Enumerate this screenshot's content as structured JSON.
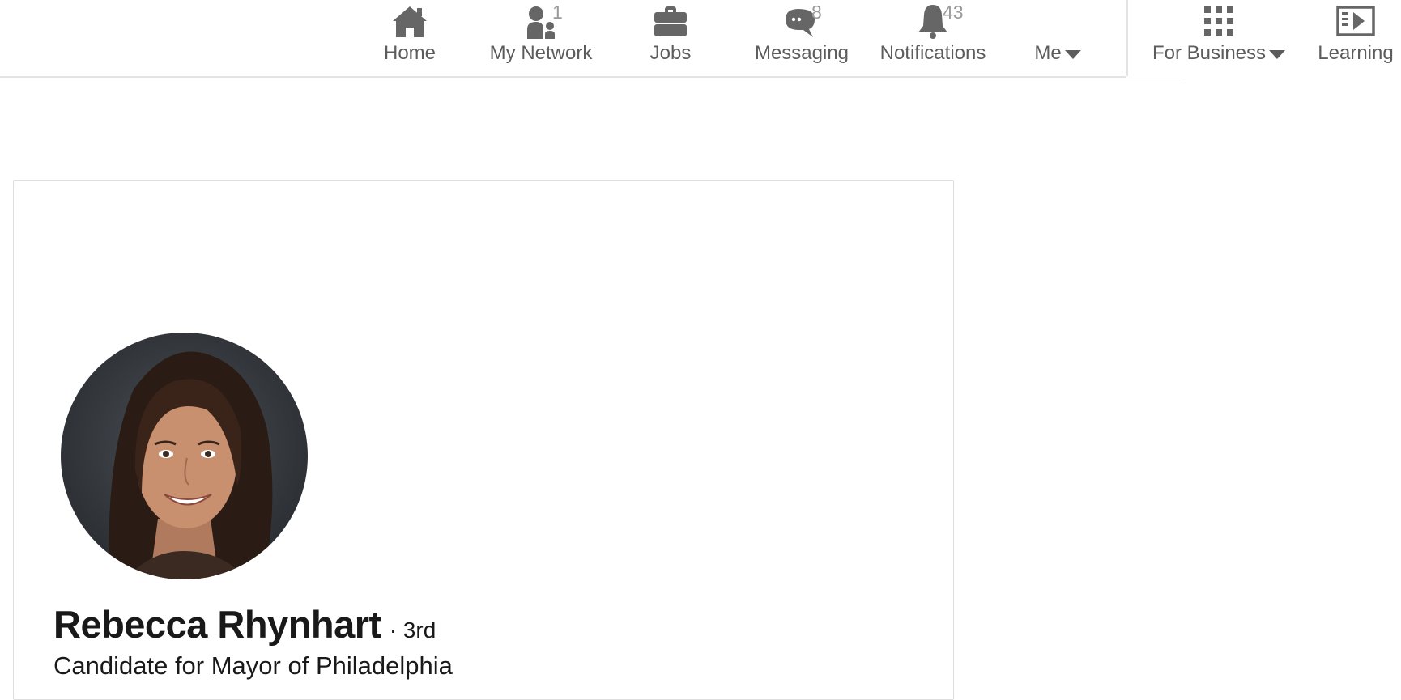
{
  "nav": {
    "home": {
      "label": "Home"
    },
    "network": {
      "label": "My Network",
      "badge": "1"
    },
    "jobs": {
      "label": "Jobs"
    },
    "messaging": {
      "label": "Messaging",
      "badge": "8"
    },
    "notifications": {
      "label": "Notifications",
      "badge": "43"
    },
    "me": {
      "label": "Me"
    },
    "for_business": {
      "label": "For Business"
    },
    "learning": {
      "label": "Learning"
    }
  },
  "profile": {
    "name": "Rebecca Rhynhart",
    "degree": "· 3rd",
    "headline": "Candidate for Mayor of Philadelphia"
  },
  "colors": {
    "nav_icon": "#666666",
    "nav_label": "#5c5c5c",
    "badge": "#9a9a9a",
    "border": "#e3e3e3",
    "text": "#191919"
  }
}
